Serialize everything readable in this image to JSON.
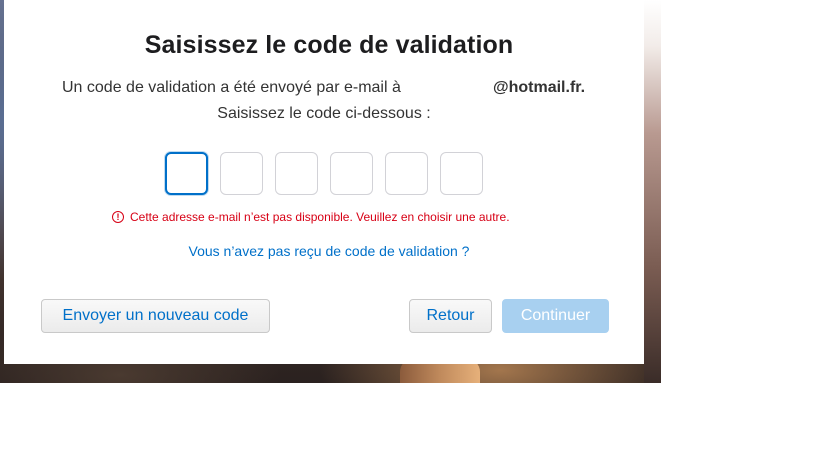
{
  "dialog": {
    "title": "Saisissez le code de validation",
    "message_line1": "Un code de validation a été envoyé par e-mail à",
    "email": "@hotmail.fr.",
    "message_line2": "Saisissez le code ci-dessous :",
    "code_digits": [
      "",
      "",
      "",
      "",
      "",
      ""
    ],
    "error_text": "Cette adresse e-mail n’est pas disponible. Veuillez en choisir une autre.",
    "error_icon": "!",
    "resend_link": "Vous n’avez pas reçu de code de validation ?",
    "buttons": {
      "new_code": "Envoyer un nouveau code",
      "back": "Retour",
      "continue": "Continuer"
    }
  },
  "colors": {
    "accent": "#0070c9",
    "error": "#d70015",
    "disabled_button": "#a8d0f0"
  }
}
